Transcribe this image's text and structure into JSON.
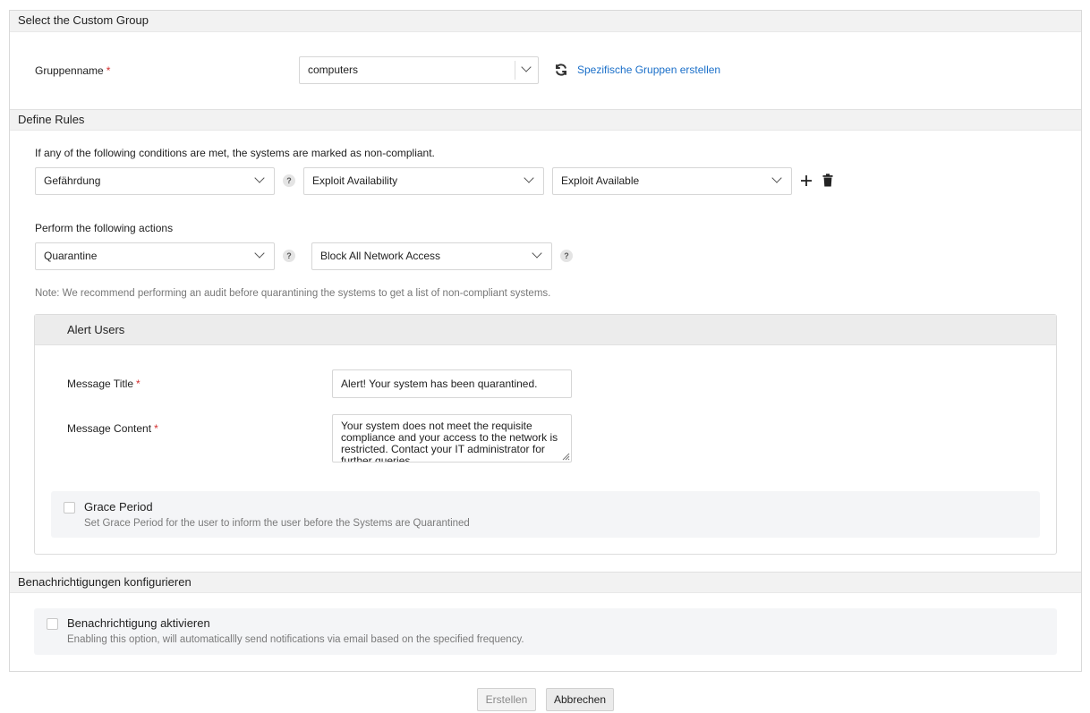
{
  "group_section": {
    "title": "Select the Custom Group",
    "group_name_label": "Gruppenname",
    "required_mark": "*",
    "group_value": "computers",
    "refresh_icon": "refresh-icon",
    "create_link": "Spezifische Gruppen erstellen"
  },
  "rules_section": {
    "title": "Define Rules",
    "condition_text": "If any of the following conditions are met, the systems are marked as non-compliant.",
    "condition": {
      "field": "Gefährdung",
      "help": "?",
      "criteria": "Exploit Availability",
      "value": "Exploit Available",
      "add_icon": "plus-icon",
      "delete_icon": "trash-icon"
    },
    "actions_text": "Perform the following actions",
    "action": {
      "type": "Quarantine",
      "help": "?",
      "subtype": "Block All Network Access",
      "help2": "?"
    },
    "note": "Note: We recommend performing an audit before quarantining the systems to get a list of non-compliant systems."
  },
  "alert_users": {
    "title": "Alert Users",
    "message_title_label": "Message Title",
    "message_title_value": "Alert! Your system has been quarantined.",
    "message_content_label": "Message Content",
    "message_content_value": "Your system does not meet the requisite compliance and your access to the network is restricted. Contact your IT administrator for further queries.",
    "grace": {
      "title": "Grace Period",
      "description": "Set Grace Period for the user to inform the user before the Systems are Quarantined",
      "checked": false
    }
  },
  "notifications_section": {
    "title": "Benachrichtigungen konfigurieren",
    "enable_title": "Benachrichtigung aktivieren",
    "enable_description": "Enabling this option, will automaticallly send notifications via email based on the specified frequency.",
    "checked": false
  },
  "footer": {
    "create_label": "Erstellen",
    "cancel_label": "Abbrechen"
  },
  "colors": {
    "link": "#1a6fc9",
    "required": "#d32f2f",
    "section_header": "#f2f2f2"
  }
}
